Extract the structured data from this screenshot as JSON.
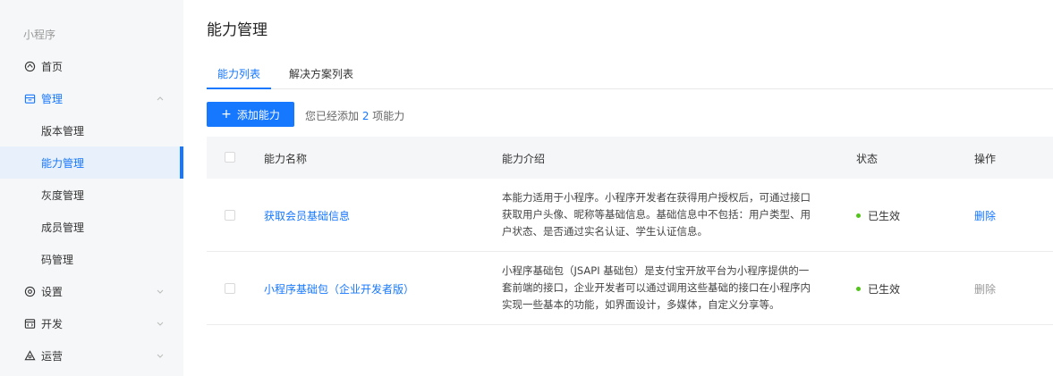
{
  "sidebar": {
    "title": "小程序",
    "items": [
      {
        "label": "首页",
        "icon": "home-icon"
      },
      {
        "label": "管理",
        "icon": "manage-icon"
      },
      {
        "label": "设置",
        "icon": "settings-icon"
      },
      {
        "label": "开发",
        "icon": "dev-icon"
      },
      {
        "label": "运营",
        "icon": "operate-icon"
      }
    ],
    "sub_items": [
      {
        "label": "版本管理"
      },
      {
        "label": "能力管理"
      },
      {
        "label": "灰度管理"
      },
      {
        "label": "成员管理"
      },
      {
        "label": "码管理"
      }
    ],
    "accent": "#1677ff"
  },
  "page": {
    "title": "能力管理",
    "tabs": [
      {
        "label": "能力列表"
      },
      {
        "label": "解决方案列表"
      }
    ],
    "add_button": "添加能力",
    "add_button_icon": "+",
    "added_prefix": "您已经添加 ",
    "added_count": "2",
    "added_suffix": " 项能力"
  },
  "table": {
    "headers": [
      "能力名称",
      "能力介绍",
      "状态",
      "操作"
    ],
    "rows": [
      {
        "name": "获取会员基础信息",
        "desc_lines": [
          "本能力适用于小程序。小程序开发者在获得用户授权后，可通过接口",
          "获取用户头像、昵称等基础信息。基础信息中不包括：用户类型、用",
          "户状态、是否通过实名认证、学生认证信息。"
        ],
        "status": "已生效",
        "action": "删除",
        "action_color": "#1677ff"
      },
      {
        "name": "小程序基础包（企业开发者版）",
        "desc_lines": [
          "小程序基础包（JSAPI 基础包）是支付宝开放平台为小程序提供的一",
          "套前端的接口，企业开发者可以通过调用这些基础的接口在小程序内",
          "实现一些基本的功能，如界面设计，多媒体，自定义分享等。"
        ],
        "status": "已生效",
        "action": "删除",
        "action_color": "#999999"
      }
    ]
  }
}
